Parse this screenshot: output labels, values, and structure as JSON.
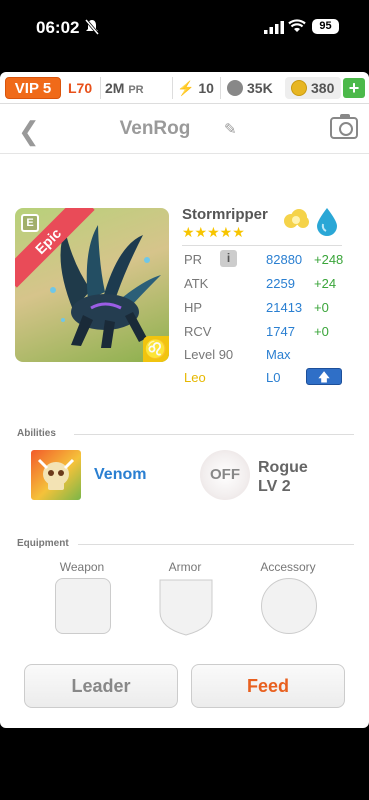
{
  "status_bar": {
    "time": "06:02",
    "battery": "95"
  },
  "top_bar": {
    "vip": "VIP 5",
    "level": "L70",
    "pr_value": "2M",
    "pr_unit": "PR",
    "energy": "10",
    "paws": "35K",
    "gold": "380",
    "add": "+"
  },
  "header": {
    "title": "VenRog"
  },
  "monster": {
    "rarity": "Epic",
    "element_badge": "E",
    "name": "Stormripper",
    "stars": "★★★★★",
    "zodiac_symbol": "♌"
  },
  "stats": [
    {
      "label": "PR",
      "value": "82880",
      "bonus": "+248"
    },
    {
      "label": "ATK",
      "value": "2259",
      "bonus": "+24"
    },
    {
      "label": "HP",
      "value": "21413",
      "bonus": "+0"
    },
    {
      "label": "RCV",
      "value": "1747",
      "bonus": "+0"
    }
  ],
  "level": {
    "label": "Level 90",
    "value": "Max"
  },
  "zodiac": {
    "label": "Leo",
    "value": "L0"
  },
  "abilities": {
    "section": "Abilities",
    "primary": "Venom",
    "secondary_state": "OFF",
    "secondary_name": "Rogue",
    "secondary_level": "LV 2"
  },
  "equipment": {
    "section": "Equipment",
    "slots": [
      "Weapon",
      "Armor",
      "Accessory"
    ]
  },
  "buttons": {
    "leader": "Leader",
    "feed": "Feed"
  },
  "colors": {
    "accent_blue": "#2a7fd1",
    "accent_orange": "#f06a19",
    "bonus_green": "#3aa53a",
    "leo_yellow": "#f1c40f"
  }
}
